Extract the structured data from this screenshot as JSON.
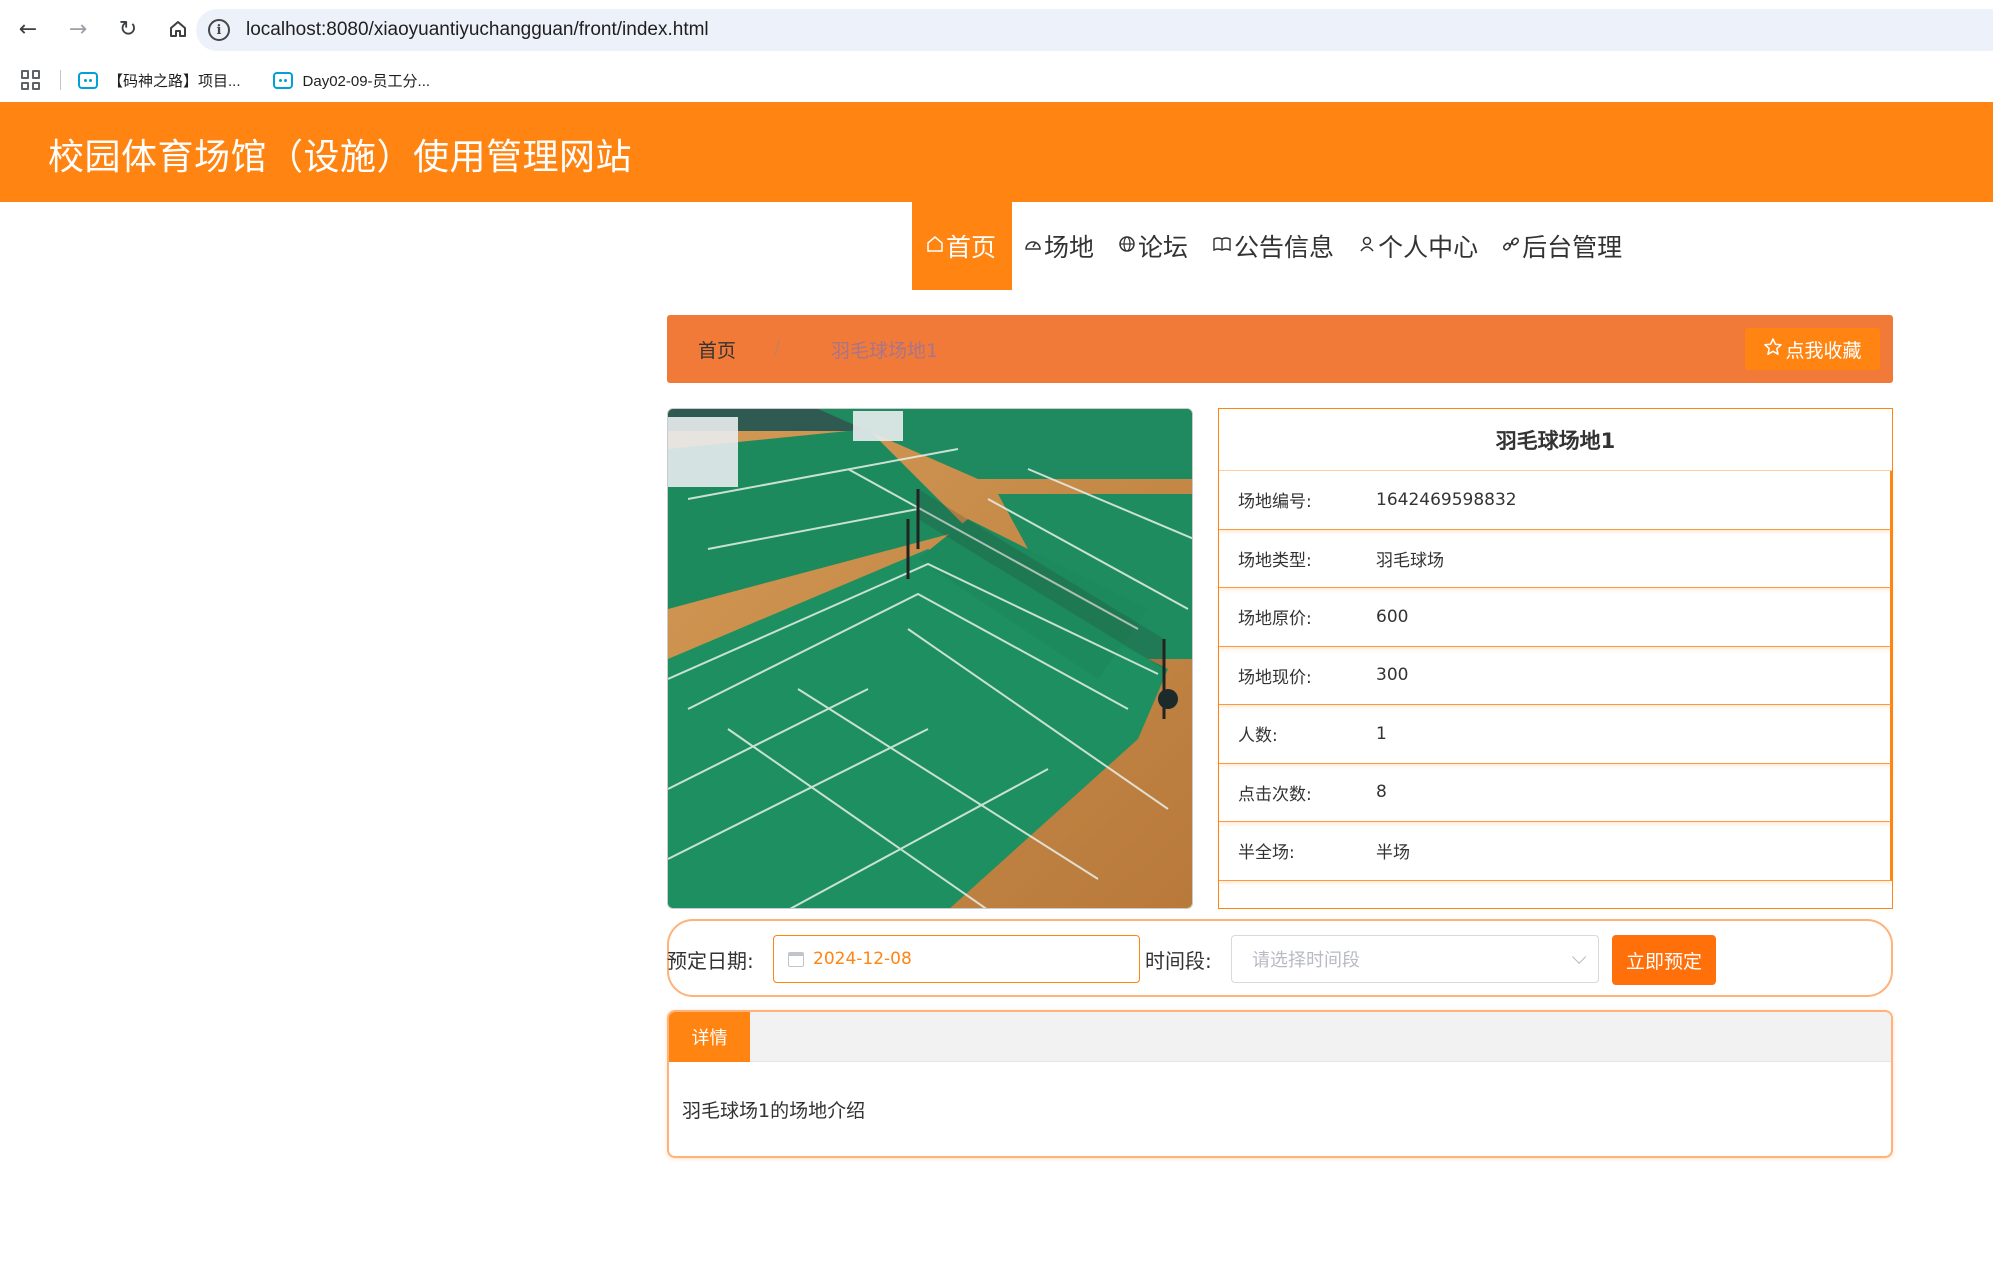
{
  "browser": {
    "url": "localhost:8080/xiaoyuantiyuchangguan/front/index.html",
    "bookmarks": [
      {
        "label": "【码神之路】项目..."
      },
      {
        "label": "Day02-09-员工分..."
      }
    ]
  },
  "site": {
    "title": "校园体育场馆（设施）使用管理网站",
    "accent_color": "#ff8412"
  },
  "nav": {
    "items": [
      {
        "label": "首页",
        "icon": "home-icon",
        "active": true
      },
      {
        "label": "场地",
        "icon": "gauge-icon"
      },
      {
        "label": "论坛",
        "icon": "globe-icon"
      },
      {
        "label": "公告信息",
        "icon": "book-icon"
      },
      {
        "label": "个人中心",
        "icon": "user-icon"
      },
      {
        "label": "后台管理",
        "icon": "link-icon"
      }
    ]
  },
  "breadcrumb": {
    "home": "首页",
    "separator": "/",
    "current": "羽毛球场地1",
    "favorite_label": "点我收藏"
  },
  "venue": {
    "name": "羽毛球场地1",
    "fields": [
      {
        "label": "场地编号:",
        "value": "1642469598832"
      },
      {
        "label": "场地类型:",
        "value": "羽毛球场"
      },
      {
        "label": "场地原价:",
        "value": "600"
      },
      {
        "label": "场地现价:",
        "value": "300"
      },
      {
        "label": "人数:",
        "value": "1"
      },
      {
        "label": "点击次数:",
        "value": "8"
      },
      {
        "label": "半全场:",
        "value": "半场"
      }
    ]
  },
  "booking": {
    "date_label": "预定日期:",
    "date_value": "2024-12-08",
    "time_label": "时间段:",
    "time_placeholder": "请选择时间段",
    "submit_label": "立即预定"
  },
  "details": {
    "tab_label": "详情",
    "content": "羽毛球场1的场地介绍"
  }
}
